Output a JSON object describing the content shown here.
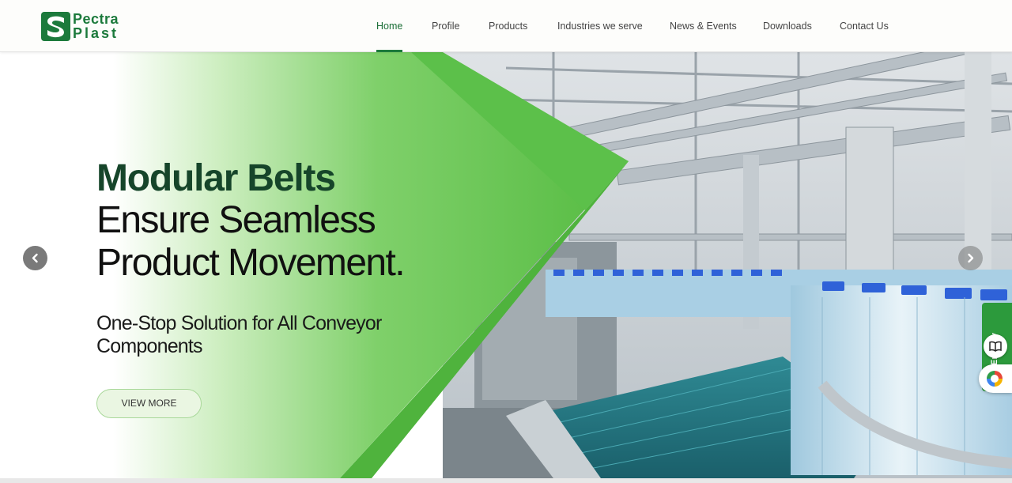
{
  "brand": {
    "name_line1": "Pectra",
    "name_line2": "Plast",
    "color": "#1c7a3c"
  },
  "nav": {
    "items": [
      {
        "label": "Home",
        "active": true
      },
      {
        "label": "Profile",
        "active": false
      },
      {
        "label": "Products",
        "active": false
      },
      {
        "label": "Industries we serve",
        "active": false
      },
      {
        "label": "News & Events",
        "active": false
      },
      {
        "label": "Downloads",
        "active": false
      },
      {
        "label": "Contact Us",
        "active": false
      }
    ]
  },
  "hero": {
    "heading_bold": "Modular Belts",
    "heading_line2": "Ensure Seamless",
    "heading_line3": "Product Movement.",
    "subheading": "One-Stop Solution for All Conveyor Components",
    "cta_label": "VIEW MORE",
    "prev_icon": "chevron-left-icon",
    "next_icon": "chevron-right-icon"
  },
  "side_widgets": {
    "enquiry_label": "Enquiry",
    "book_icon": "book-icon",
    "translate_icon": "globe-icon"
  },
  "colors": {
    "accent_green": "#2c9a3c",
    "heading_green": "#16452a",
    "shape_green": "#5cc04a"
  }
}
